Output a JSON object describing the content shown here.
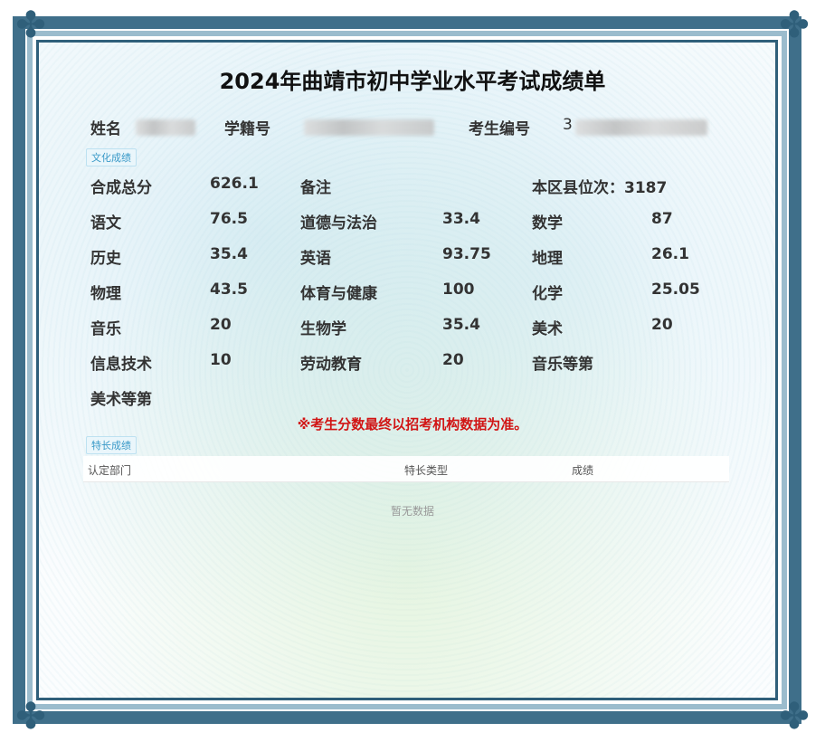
{
  "title": "2024年曲靖市初中学业水平考试成绩单",
  "student": {
    "name_label": "姓名",
    "id_label": "学籍号",
    "exam_no_label": "考生编号",
    "exam_no_prefix": "3"
  },
  "culture_section": {
    "tag": "文化成绩"
  },
  "scores": [
    [
      {
        "label": "合成总分",
        "value": "626.1"
      },
      {
        "label": "备注",
        "value": ""
      },
      {
        "label": "本区县位次：3187",
        "value": ""
      }
    ],
    [
      {
        "label": "语文",
        "value": "76.5"
      },
      {
        "label": "道德与法治",
        "value": "33.4"
      },
      {
        "label": "数学",
        "value": "87"
      }
    ],
    [
      {
        "label": "历史",
        "value": "35.4"
      },
      {
        "label": "英语",
        "value": "93.75"
      },
      {
        "label": "地理",
        "value": "26.1"
      }
    ],
    [
      {
        "label": "物理",
        "value": "43.5"
      },
      {
        "label": "体育与健康",
        "value": "100"
      },
      {
        "label": "化学",
        "value": "25.05"
      }
    ],
    [
      {
        "label": "音乐",
        "value": "20"
      },
      {
        "label": "生物学",
        "value": "35.4"
      },
      {
        "label": "美术",
        "value": "20"
      }
    ],
    [
      {
        "label": "信息技术",
        "value": "10"
      },
      {
        "label": "劳动教育",
        "value": "20"
      },
      {
        "label": "音乐等第",
        "value": ""
      }
    ],
    [
      {
        "label": "美术等第",
        "value": ""
      }
    ]
  ],
  "notice": "※考生分数最终以招考机构数据为准。",
  "special_section": {
    "tag": "特长成绩",
    "columns": [
      "认定部门",
      "特长类型",
      "成绩"
    ],
    "empty_text": "暂无数据"
  },
  "colors": {
    "border": "#3f6f8a",
    "notice": "#d11414",
    "tag": "#3a9ac8"
  }
}
